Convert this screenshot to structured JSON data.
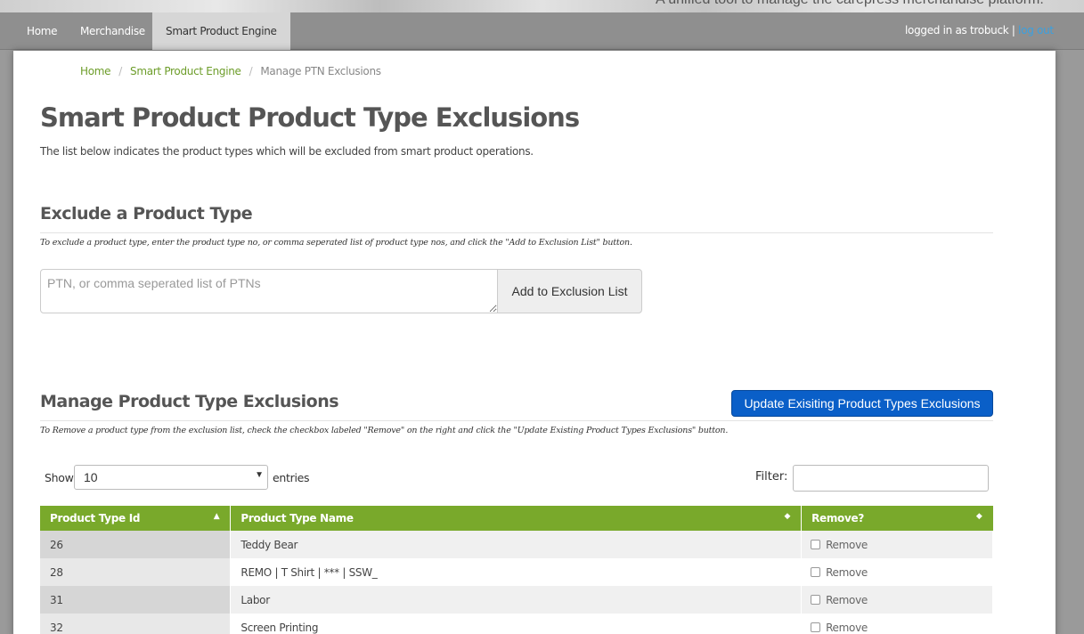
{
  "banner": {
    "tagline": "A unified tool to manage the carepress merchandise platform."
  },
  "nav": {
    "items": [
      {
        "label": "Home",
        "active": false
      },
      {
        "label": "Merchandise",
        "active": false
      },
      {
        "label": "Smart Product Engine",
        "active": true
      }
    ],
    "user_text": "logged in as trobuck",
    "separator": "|",
    "logout_label": "log out"
  },
  "breadcrumb": {
    "home": "Home",
    "engine": "Smart Product Engine",
    "current": "Manage PTN Exclusions",
    "sep": "/"
  },
  "page": {
    "title": "Smart Product Product Type Exclusions",
    "description": "The list below indicates the product types which will be excluded from smart product operations."
  },
  "exclude_section": {
    "title": "Exclude a Product Type",
    "note": "To exclude a product type, enter the product type no, or comma seperated list of product type nos, and click the \"Add to Exclusion List\" button.",
    "placeholder": "PTN, or comma seperated list of PTNs",
    "value": "",
    "add_button": "Add to Exclusion List"
  },
  "manage_section": {
    "title": "Manage Product Type Exclusions",
    "update_button": "Update Exisiting Product Types Exclusions",
    "note": "To Remove a product type from the exclusion list, check the checkbox labeled \"Remove\" on the right and click the \"Update Existing Product Types Exclusions\" button."
  },
  "table_controls": {
    "show_label": "Show",
    "page_size": "10",
    "entries_label": "entries",
    "filter_label": "Filter:",
    "filter_value": ""
  },
  "table": {
    "headers": [
      "Product Type Id",
      "Product Type Name",
      "Remove?"
    ],
    "rows": [
      {
        "id": "26",
        "name": "Teddy Bear",
        "remove_label": "Remove",
        "checked": false
      },
      {
        "id": "28",
        "name": "REMO | T Shirt | *** | SSW_",
        "remove_label": "Remove",
        "checked": false
      },
      {
        "id": "31",
        "name": "Labor",
        "remove_label": "Remove",
        "checked": false
      },
      {
        "id": "32",
        "name": "Screen Printing",
        "remove_label": "Remove",
        "checked": false
      }
    ]
  },
  "colors": {
    "nav_bg": "#8f8f8f",
    "accent_green": "#79a92b",
    "link_green": "#6d9d2a",
    "primary_blue": "#0a5fc8",
    "logout_blue": "#3aa0e0"
  }
}
